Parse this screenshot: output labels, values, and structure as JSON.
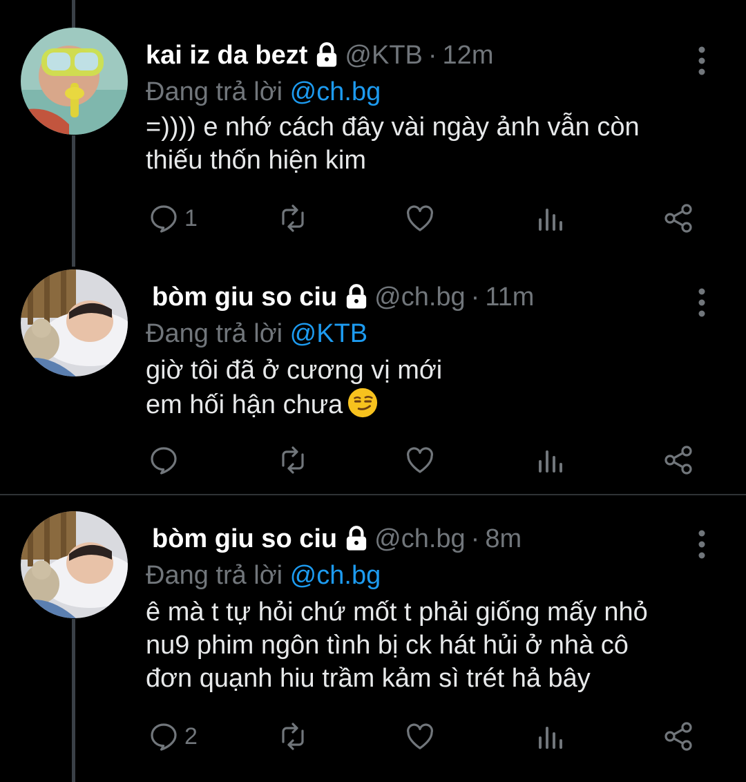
{
  "tweets": [
    {
      "name": "kai iz da bezt",
      "handle": "@KTB",
      "dot": "·",
      "time": "12m",
      "reply_prefix": "Đang trả lời",
      "reply_to": "@ch.bg",
      "lines": [
        "=)))) e nhớ cách đây vài ngày ảnh vẫn còn",
        "thiếu thốn hiện kim"
      ],
      "reply_count": "1",
      "avatar": "snorkel-avatar"
    },
    {
      "name": "bòm giu so ciu",
      "handle": "@ch.bg",
      "dot": "·",
      "time": "11m",
      "reply_prefix": "Đang trả lời",
      "reply_to": "@KTB",
      "lines": [
        "giờ tôi đã ở cương vị mới",
        "em hối hận chưa"
      ],
      "reply_count": "",
      "avatar": "sleeping-child-avatar",
      "emoji": "smirking-face"
    },
    {
      "name": "bòm giu so ciu",
      "handle": "@ch.bg",
      "dot": "·",
      "time": "8m",
      "reply_prefix": "Đang trả lời",
      "reply_to": "@ch.bg",
      "lines": [
        "ê mà t tự hỏi chứ mốt t phải giống mấy nhỏ",
        "nu9 phim ngôn tình bị ck hát hủi ở nhà cô",
        "đơn quạnh hiu trầm kảm sì trét hả bây"
      ],
      "reply_count": "2",
      "avatar": "sleeping-child-avatar"
    }
  ],
  "icons": {
    "reply": "reply-icon",
    "retweet": "retweet-icon",
    "like": "like-icon",
    "views": "views-icon",
    "share": "share-icon",
    "more": "more-options-icon",
    "lock": "lock-icon"
  },
  "colors": {
    "background": "#000000",
    "text": "#e7e9ea",
    "secondary": "#71767b",
    "accent": "#1d9bf0",
    "thread_line": "#3a4047",
    "separator": "#2f3336"
  }
}
